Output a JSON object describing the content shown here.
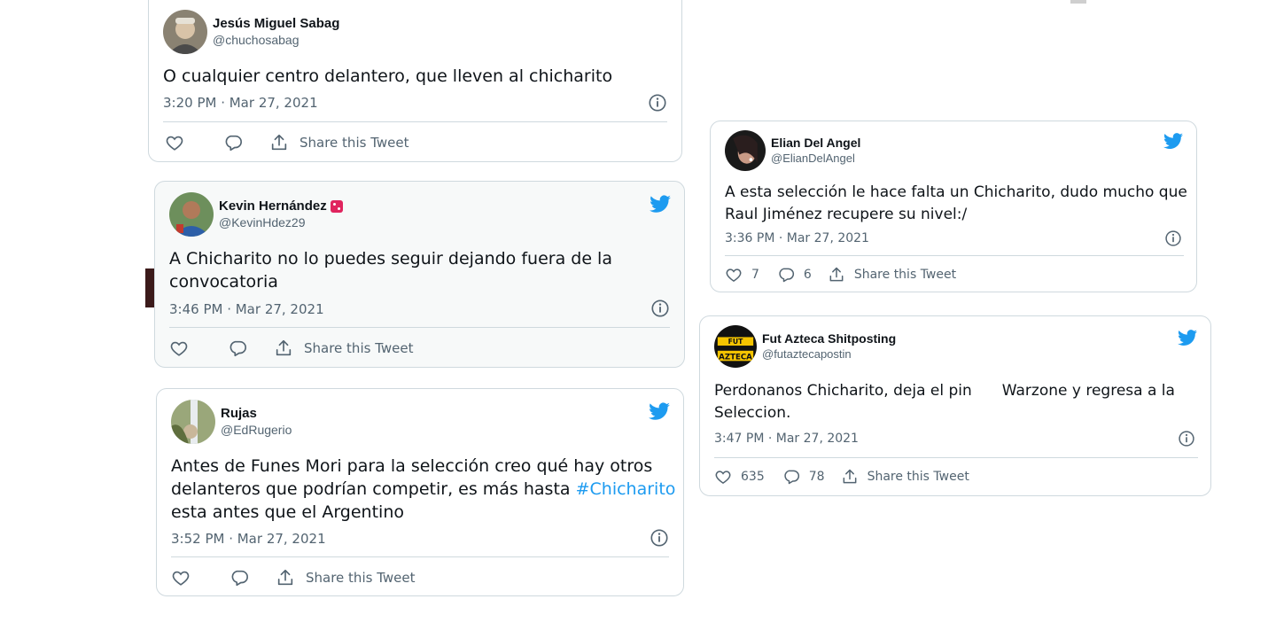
{
  "tweets": [
    {
      "name": "Jesús Miguel Sabag",
      "handle": "@chuchosabag",
      "text": "O cualquier centro delantero, que lleven al chicharito",
      "time": "3:20 PM · Mar 27, 2021",
      "share_label": "Share this Tweet"
    },
    {
      "name": "Kevin Hernández",
      "handle": "@KevinHdez29",
      "text_line1": "A Chicharito no lo puedes seguir dejando fuera de la",
      "text_line2": "convocatoria",
      "time": "3:46 PM · Mar 27, 2021",
      "share_label": "Share this Tweet"
    },
    {
      "name": "Rujas",
      "handle": "@EdRugerio",
      "text_line1": "Antes de Funes Mori para la selección creo qué hay otros",
      "text_line2a": "delanteros que podrían competir, es más hasta ",
      "hashtag": "#Chicharito",
      "text_line3": "esta antes que el Argentino",
      "time": "3:52 PM · Mar 27, 2021",
      "share_label": "Share this Tweet"
    },
    {
      "name": "Elian Del Angel",
      "handle": "@ElianDelAngel",
      "text_line1": "A esta selección le hace falta un Chicharito, dudo mucho que",
      "text_line2": "Raul Jiménez recupere su nivel:/",
      "time": "3:36 PM · Mar 27, 2021",
      "likes": "7",
      "replies": "6",
      "share_label": "Share this Tweet"
    },
    {
      "name": "Fut Azteca Shitposting",
      "handle": "@futaztecapostin",
      "text_line1a": "Perdonanos Chicharito, deja el pin",
      "text_line1b": "Warzone y regresa a la",
      "text_line2": "Seleccion.",
      "time": "3:47 PM · Mar 27, 2021",
      "likes": "635",
      "replies": "78",
      "share_label": "Share this Tweet",
      "avatar_text_top": "FUT",
      "avatar_text_bottom": "AZTECA"
    }
  ],
  "colors": {
    "twitter_blue": "#1d9bf0",
    "border": "#cfd9de",
    "muted": "#536471",
    "text": "#0f1419"
  },
  "icons": [
    "twitter-bird-icon",
    "heart-icon",
    "reply-icon",
    "share-icon",
    "info-icon",
    "dice-emoji-icon"
  ]
}
